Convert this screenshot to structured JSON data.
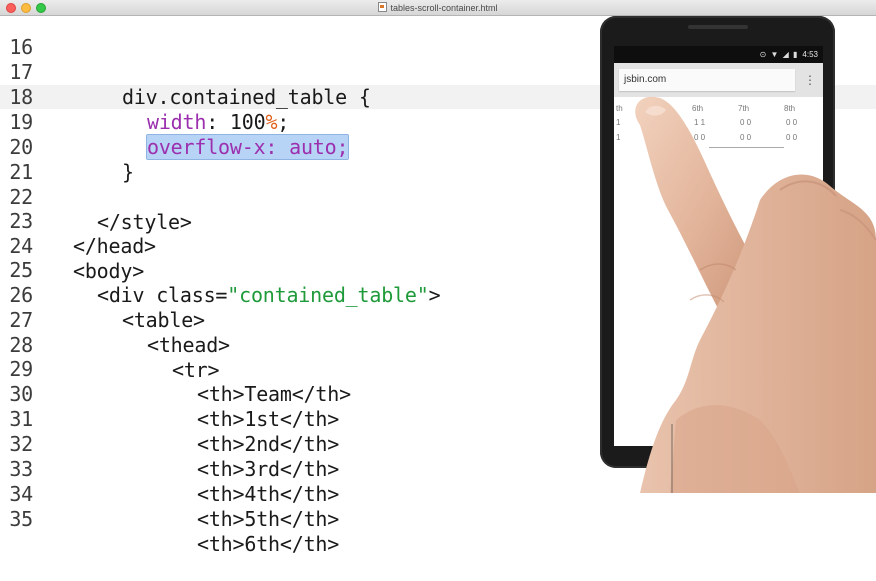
{
  "window": {
    "title": "tables-scroll-container.html"
  },
  "editor": {
    "current_line": 19,
    "lines": [
      {
        "num": "16",
        "text": ""
      },
      {
        "num": "17",
        "text": "div.contained_table {"
      },
      {
        "num": "18",
        "prop": "width",
        "sep": ": ",
        "value": "100",
        "pct": "%",
        "end": ";"
      },
      {
        "num": "19",
        "selected": "overflow-x: auto;"
      },
      {
        "num": "20",
        "text": "}"
      },
      {
        "num": "21",
        "text": ""
      },
      {
        "num": "22",
        "text": "</style>"
      },
      {
        "num": "23",
        "text": "</head>"
      },
      {
        "num": "24",
        "text": "<body>"
      },
      {
        "num": "25",
        "pre": "<div class=",
        "str": "\"contained_table\"",
        "post": ">"
      },
      {
        "num": "26",
        "text": "<table>"
      },
      {
        "num": "27",
        "text": "<thead>"
      },
      {
        "num": "28",
        "text": "<tr>"
      },
      {
        "num": "29",
        "text": "<th>Team</th>"
      },
      {
        "num": "30",
        "text": "<th>1st</th>"
      },
      {
        "num": "31",
        "text": "<th>2nd</th>"
      },
      {
        "num": "32",
        "text": "<th>3rd</th>"
      },
      {
        "num": "33",
        "text": "<th>4th</th>"
      },
      {
        "num": "34",
        "text": "<th>5th</th>"
      },
      {
        "num": "35",
        "text": "<th>6th</th>"
      }
    ],
    "line19_prop": "overflow-x",
    "line19_rest": ": auto;"
  },
  "phone": {
    "time": "4:53",
    "status_icons": "⊙ ▼ ◢ ▮",
    "url": "jsbin.com",
    "menu": "⋮",
    "table_header": [
      "th",
      "5th",
      "6th",
      "7th",
      "8th"
    ],
    "row1": [
      "1",
      "1",
      "1 1",
      "0 0",
      "0 0"
    ],
    "row2": [
      "1",
      "",
      "0 0",
      "0 0",
      "0 0"
    ]
  },
  "colors": {
    "property": "#9c2fae",
    "percent": "#e0601a",
    "string": "#1f9a3a",
    "selection": "#b7d3f5"
  }
}
